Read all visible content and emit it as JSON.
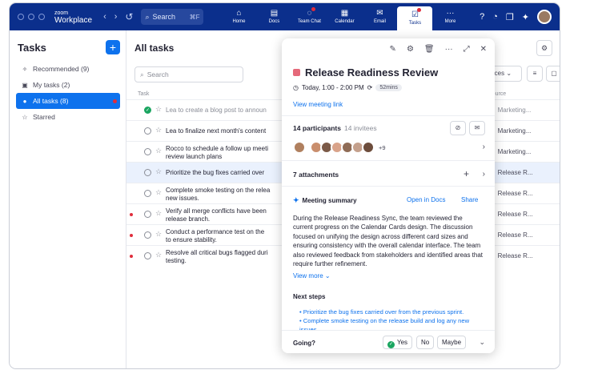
{
  "app": {
    "brand_top": "zoom",
    "brand_name": "Workplace",
    "search_label": "Search",
    "search_shortcut": "⌘F"
  },
  "nav": {
    "tabs": [
      {
        "label": "Home"
      },
      {
        "label": "Docs"
      },
      {
        "label": "Team Chat"
      },
      {
        "label": "Calendar"
      },
      {
        "label": "Email"
      },
      {
        "label": "Tasks"
      },
      {
        "label": "More"
      }
    ]
  },
  "sidebar": {
    "title": "Tasks",
    "add_label": "+",
    "items": [
      {
        "label": "Recommended (9)"
      },
      {
        "label": "My tasks (2)"
      },
      {
        "label": "All tasks (8)"
      },
      {
        "label": "Starred"
      }
    ]
  },
  "main": {
    "title": "All tasks",
    "search_placeholder": "Search",
    "col_task": "Task",
    "col_source": "Source",
    "filter_label": "rces",
    "rows": [
      {
        "text": "Lea to create a blog post to announ",
        "source": "Marketing..."
      },
      {
        "text": "Lea to finalize next month's content",
        "source": "Marketing..."
      },
      {
        "text": "Rocco to schedule a follow up meeti review launch plans",
        "source": "Marketing..."
      },
      {
        "text": "Prioritize the bug fixes carried over",
        "source": "Release R..."
      },
      {
        "text": "Complete smoke testing on the relea new issues.",
        "source": "Release R..."
      },
      {
        "text": "Verify all merge conflicts have been release branch.",
        "source": "Release R..."
      },
      {
        "text": "Conduct a performance test on the to ensure stability.",
        "source": "Release R..."
      },
      {
        "text": "Resolve all critical bugs flagged duri testing.",
        "source": "Release R..."
      }
    ]
  },
  "panel": {
    "title": "Release Readiness Review",
    "time": "Today, 1:00 - 2:00 PM",
    "duration": "52mins",
    "meeting_link": "View meeting link",
    "participants": "14 participants",
    "invitees": "14 invitees",
    "avatars_more": "+9",
    "attachments": "7 attachments",
    "summary_title": "Meeting summary",
    "open_in_docs": "Open in Docs",
    "share": "Share",
    "summary_body": "During the Release Readiness Sync, the team reviewed the current progress on the Calendar Cards design. The discussion focused on unifying the design across different card sizes and ensuring consistency with the overall calendar interface. The team also reviewed feedback from stakeholders and identified areas that require further refinement.",
    "view_more": "View more",
    "next_steps_title": "Next steps",
    "next_steps": [
      "Prioritize the bug fixes carried over from the previous sprint.",
      "Complete smoke testing on the release build and log any new issues."
    ],
    "going": "Going?",
    "yes": "Yes",
    "no": "No",
    "maybe": "Maybe"
  }
}
